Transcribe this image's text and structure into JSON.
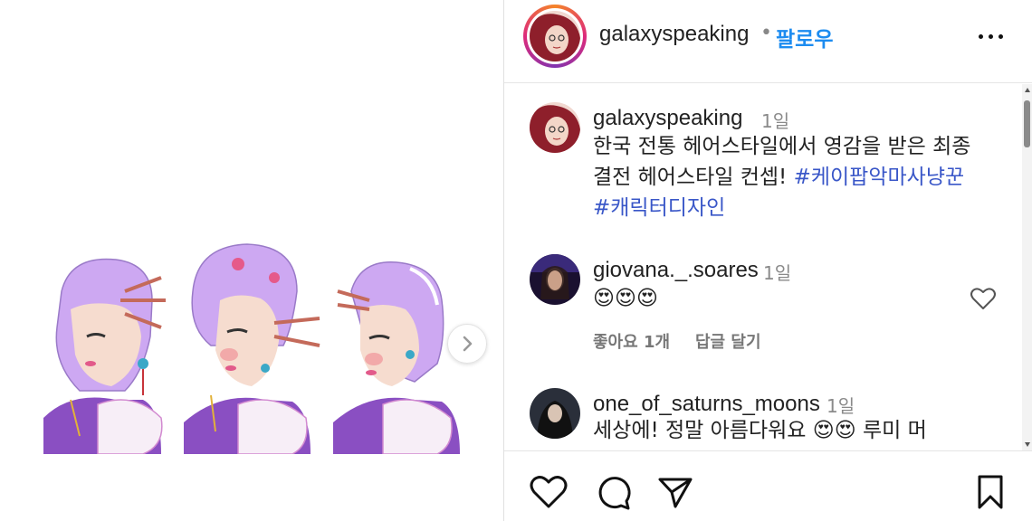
{
  "post": {
    "author": "galaxyspeaking",
    "separator": "•",
    "follow_label": "팔로우"
  },
  "caption": {
    "username": "galaxyspeaking",
    "time": "1일",
    "text_line1": "한국 전통 헤어스타일에서 영감을 받은 최종",
    "text_line2": "결전 헤어스타일 컨셉! ",
    "tag1": "#케이팝악마사냥꾼",
    "tag2": "#캐릭터디자인"
  },
  "comments": [
    {
      "username": "giovana._.soares",
      "time": "1일",
      "text": "😍😍😍",
      "likes": "좋아요 1개",
      "reply": "답글 달기"
    },
    {
      "username": "one_of_saturns_moons",
      "time": "1일",
      "text": "세상에! 정말 아름다워요 😍😍 루미 머"
    }
  ],
  "icons": {
    "like": "heart-icon",
    "comment": "comment-icon",
    "share": "send-icon",
    "save": "bookmark-icon",
    "next": "chevron-right-icon",
    "more": "more-options-icon"
  },
  "colors": {
    "follow": "#1d8cf0",
    "hashtag": "#3a57c8",
    "hair": "#c9a6f0"
  }
}
